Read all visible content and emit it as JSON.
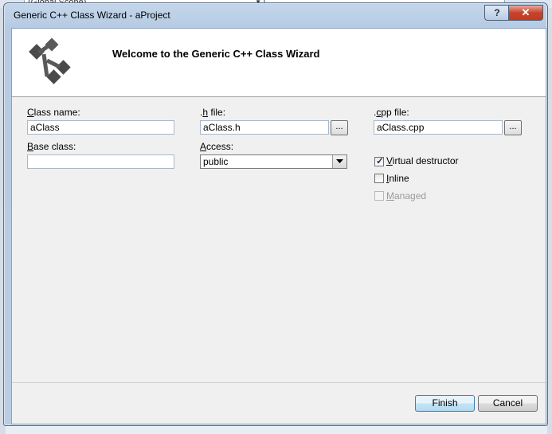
{
  "background": {
    "scope_combo": "(Global Scope)"
  },
  "window": {
    "title": "Generic C++ Class Wizard - aProject",
    "help_label": "?",
    "close_label": "✕"
  },
  "header": {
    "title": "Welcome to the Generic C++ Class Wizard",
    "logo_icon": "class-wizard-icon"
  },
  "form": {
    "class_name": {
      "label_underline": "C",
      "label_rest": "lass name:",
      "value": "aClass"
    },
    "h_file": {
      "label_pre": ".",
      "label_underline": "h",
      "label_rest": " file:",
      "value": "aClass.h",
      "browse": "..."
    },
    "cpp_file": {
      "label_pre": ".",
      "label_underline": "c",
      "label_rest": "pp file:",
      "value": "aClass.cpp",
      "browse": "..."
    },
    "base_class": {
      "label_underline": "B",
      "label_rest": "ase class:",
      "value": ""
    },
    "access": {
      "label_underline": "A",
      "label_rest": "ccess:",
      "value": "public"
    },
    "virtual_destructor": {
      "label_underline": "V",
      "label_rest": "irtual destructor",
      "checked": true
    },
    "inline": {
      "label_underline": "I",
      "label_rest": "nline",
      "checked": false
    },
    "managed": {
      "label_underline": "M",
      "label_rest": "anaged",
      "checked": false,
      "disabled": true
    }
  },
  "buttons": {
    "finish": "Finish",
    "cancel": "Cancel"
  },
  "colors": {
    "close_button": "#c8432c",
    "default_button": "#3c7fb1"
  }
}
